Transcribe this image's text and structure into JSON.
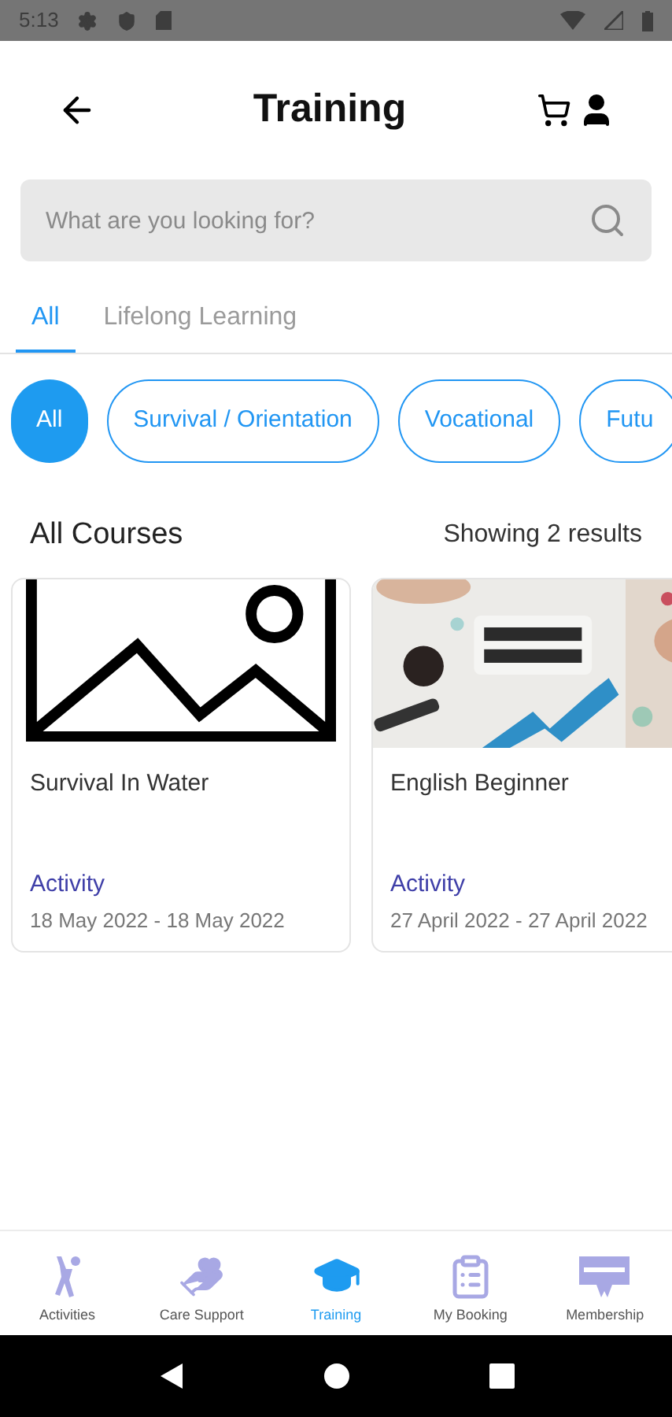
{
  "status_bar": {
    "time": "5:13"
  },
  "header": {
    "title": "Training"
  },
  "search": {
    "placeholder": "What are you looking for?"
  },
  "tabs": [
    {
      "label": "All",
      "selected": true
    },
    {
      "label": "Lifelong Learning",
      "selected": false
    }
  ],
  "chips": [
    {
      "label": "All",
      "selected": true
    },
    {
      "label": "Survival / Orientation",
      "selected": false
    },
    {
      "label": "Vocational",
      "selected": false
    },
    {
      "label": "Futu",
      "selected": false
    }
  ],
  "section": {
    "title": "All Courses",
    "results": "Showing 2 results"
  },
  "courses": [
    {
      "kind": "placeholder",
      "title": "Survival In Water",
      "category": "Activity",
      "dates": "18 May 2022 - 18 May 2022"
    },
    {
      "kind": "picture",
      "title": "English Beginner",
      "category": "Activity",
      "dates": "27 April 2022 - 27 April 2022"
    }
  ],
  "bottom_nav": [
    {
      "kind": "activities",
      "label": "Activities",
      "selected": false
    },
    {
      "kind": "care",
      "label": "Care Support",
      "selected": false
    },
    {
      "kind": "training",
      "label": "Training",
      "selected": true
    },
    {
      "kind": "booking",
      "label": "My Booking",
      "selected": false
    },
    {
      "kind": "membership",
      "label": "Membership",
      "selected": false
    }
  ]
}
